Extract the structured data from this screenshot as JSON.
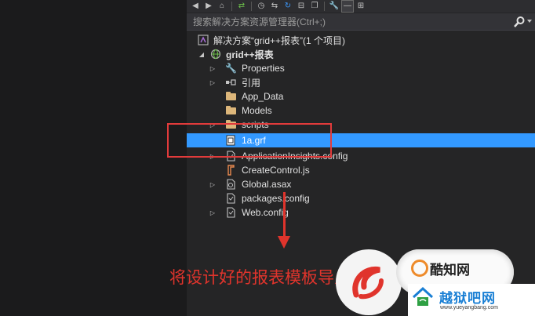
{
  "search": {
    "placeholder": "搜索解决方案资源管理器(Ctrl+;)"
  },
  "tree": {
    "solution_label": "解决方案“grid++报表”(1 个项目)",
    "project_label": "grid++报表",
    "items": [
      {
        "label": "Properties",
        "icon": "wrench-icon",
        "expandable": true
      },
      {
        "label": "引用",
        "icon": "references-icon",
        "expandable": true
      },
      {
        "label": "App_Data",
        "icon": "folder-icon",
        "expandable": false
      },
      {
        "label": "Models",
        "icon": "folder-icon",
        "expandable": false
      },
      {
        "label": "scripts",
        "icon": "folder-icon",
        "expandable": true
      },
      {
        "label": "1a.grf",
        "icon": "grf-file-icon",
        "expandable": false,
        "selected": true
      },
      {
        "label": "ApplicationInsights.config",
        "icon": "config-file-icon",
        "expandable": true
      },
      {
        "label": "CreateControl.js",
        "icon": "js-file-icon",
        "expandable": false
      },
      {
        "label": "Global.asax",
        "icon": "asax-file-icon",
        "expandable": true
      },
      {
        "label": "packages.config",
        "icon": "config-file-icon",
        "expandable": false
      },
      {
        "label": "Web.config",
        "icon": "config-file-icon",
        "expandable": true
      }
    ]
  },
  "annotation": {
    "caption": "将设计好的报表模板导入"
  },
  "watermark": {
    "cloud_text": "酷知网",
    "brand_title": "越狱吧网",
    "brand_url": "www.yueyangbang.com"
  },
  "colors": {
    "selection": "#3399ff",
    "annotation_red": "#e0342c",
    "panel_bg": "#252526"
  }
}
